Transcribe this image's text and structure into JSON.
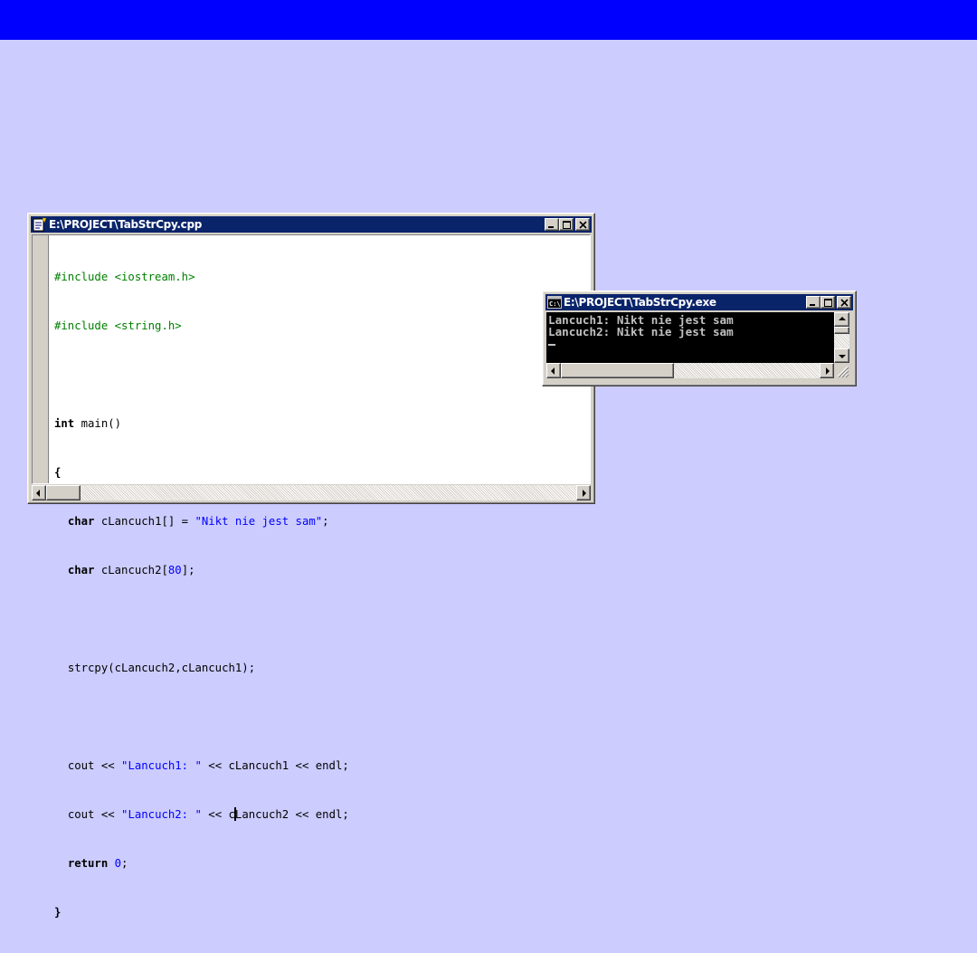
{
  "colors": {
    "page_background": "#ccccff",
    "top_bar": "#0000ff",
    "titlebar_active": "#0a246a",
    "keyword": "#000000",
    "preprocessor": "#008000",
    "string_literal": "#0000ff",
    "console_text": "#c0c0c0"
  },
  "editor": {
    "title": "E:\\PROJECT\\TabStrCpy.cpp",
    "icon": "cpp-source-file-icon",
    "code": {
      "l1": "#include <iostream.h>",
      "l2": "#include <string.h>",
      "l4_kw": "int",
      "l4_rest": " main()",
      "l5": "{",
      "l6_kw": "char",
      "l6_a": " cLancuch1[] = ",
      "l6_str": "\"Nikt nie jest sam\"",
      "l6_b": ";",
      "l7_kw": "char",
      "l7_a": " cLancuch2[",
      "l7_num": "80",
      "l7_b": "];",
      "l9": "strcpy(cLancuch2,cLancuch1);",
      "l11_a": "cout << ",
      "l11_str": "\"Lancuch1: \"",
      "l11_b": " << cLancuch1 << endl;",
      "l12_a": "cout << ",
      "l12_str": "\"Lancuch2: \"",
      "l12_b": " << c",
      "l12_c": "Lancuch2 << endl;",
      "l13_kw": "return",
      "l13_sp": " ",
      "l13_num": "0",
      "l13_b": ";",
      "l14": "}"
    }
  },
  "console": {
    "title": "E:\\PROJECT\\TabStrCpy.exe",
    "icon": "console-icon",
    "lines": [
      "Lancuch1: Nikt nie jest sam",
      "Lancuch2: Nikt nie jest sam"
    ]
  }
}
